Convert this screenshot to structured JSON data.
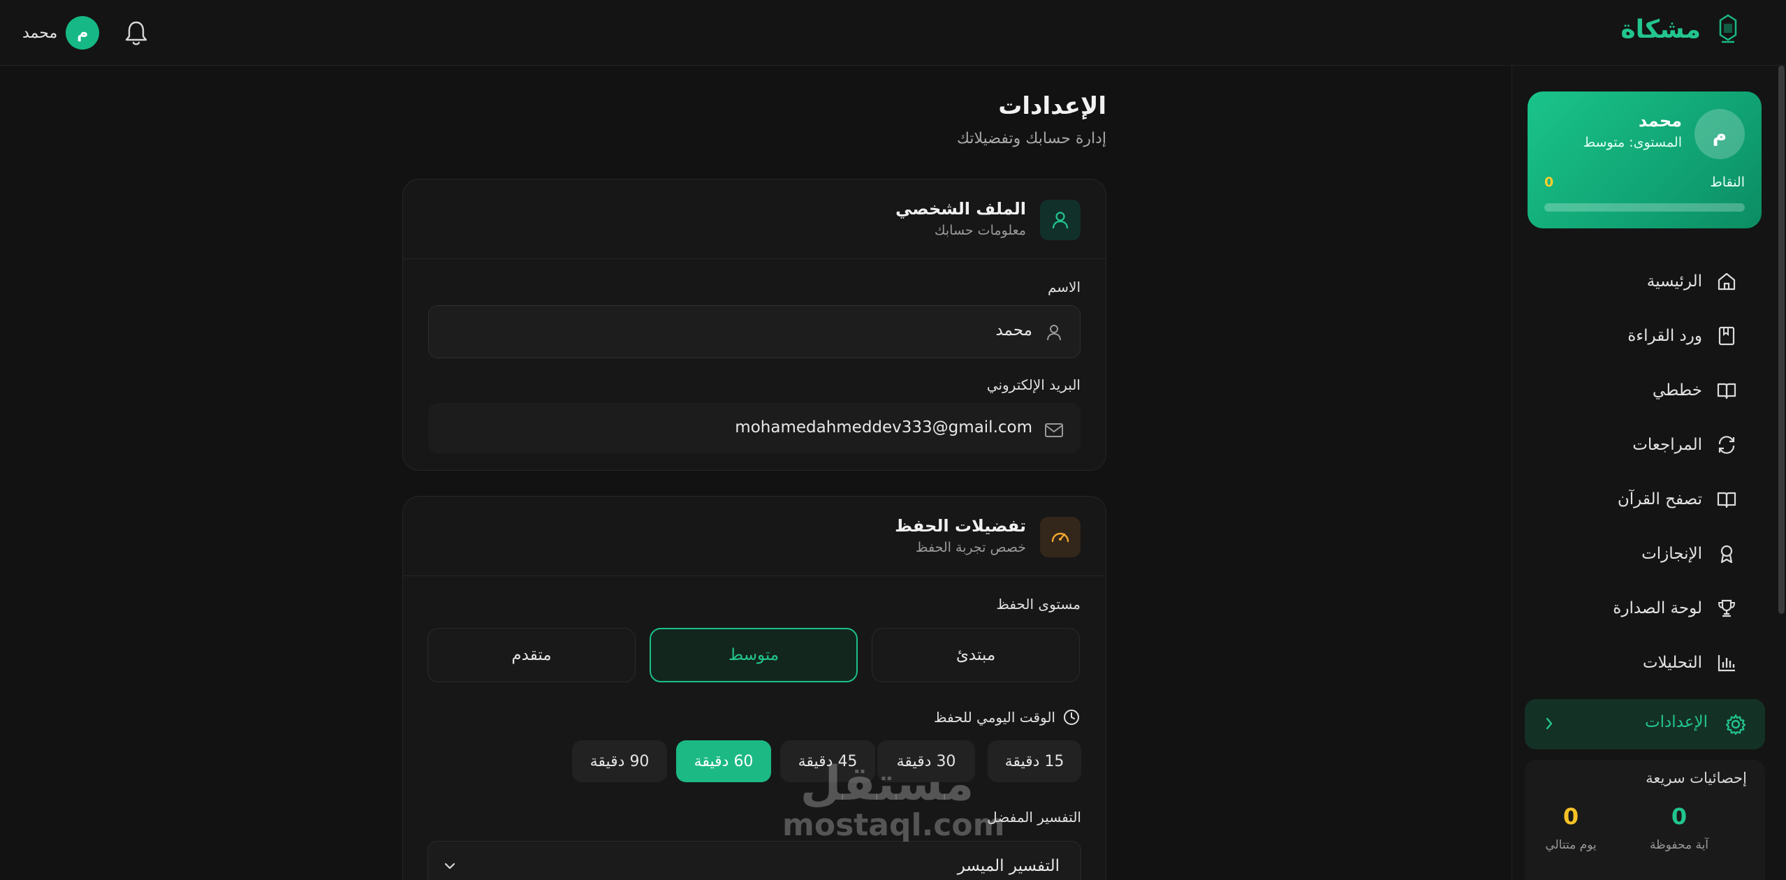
{
  "app": {
    "name": "مشكاة"
  },
  "header": {
    "user_initial": "م",
    "user_name": "محمد"
  },
  "sidebar": {
    "profile": {
      "initial": "م",
      "name": "محمد",
      "level": "المستوى: متوسط",
      "points_label": "النقاط",
      "points_value": "0",
      "points_progress": 0
    },
    "items": [
      {
        "label": "الرئيسية",
        "icon": "home-icon"
      },
      {
        "label": "ورد القراءة",
        "icon": "bookmark-book-icon"
      },
      {
        "label": "خططي",
        "icon": "open-book-icon"
      },
      {
        "label": "المراجعات",
        "icon": "refresh-icon"
      },
      {
        "label": "تصفح القرآن",
        "icon": "open-book-icon"
      },
      {
        "label": "الإنجازات",
        "icon": "award-icon"
      },
      {
        "label": "لوحة الصدارة",
        "icon": "trophy-icon"
      },
      {
        "label": "التحليلات",
        "icon": "bar-chart-icon"
      }
    ],
    "active_item": {
      "label": "الإعدادات",
      "icon": "gear-icon"
    },
    "quick_stats": {
      "title": "إحصائيات سريعة",
      "memorized_value": "0",
      "memorized_label": "آية محفوظة",
      "streak_value": "0",
      "streak_label": "يوم متتالي"
    }
  },
  "page": {
    "title": "الإعدادات",
    "subtitle": "إدارة حسابك وتفضيلاتك"
  },
  "profile_card": {
    "title": "الملف الشخصي",
    "subtitle": "معلومات حسابك",
    "name_label": "الاسم",
    "name_value": "محمد",
    "email_label": "البريد الإلكتروني",
    "email_value": "mohamedahmeddev333@gmail.com"
  },
  "pref_card": {
    "title": "تفضيلات الحفظ",
    "subtitle": "خصص تجربة الحفظ",
    "level_label": "مستوى الحفظ",
    "levels": [
      "مبتدئ",
      "متوسط",
      "متقدم"
    ],
    "selected_level": "متوسط",
    "daily_time_label": "الوقت اليومي للحفظ",
    "times": [
      "15 دقيقة",
      "30 دقيقة",
      "45 دقيقة",
      "60 دقيقة",
      "90 دقيقة"
    ],
    "selected_time": "60 دقيقة",
    "tafsir_label": "التفسير المفضل",
    "tafsir_value": "التفسير الميسر"
  },
  "watermark": {
    "line1": "مستقل",
    "line2": "mostaql.com"
  },
  "colors": {
    "accent": "#1cb985",
    "gold": "#f5c227",
    "background": "#121212"
  }
}
